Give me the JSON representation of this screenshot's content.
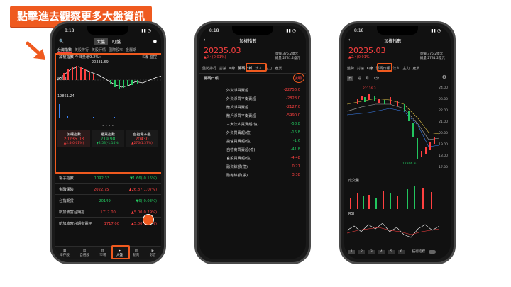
{
  "banner": "點擊進去觀察更多大盤資訊",
  "time": "8:18",
  "phone1": {
    "top_tabs": [
      "大盤",
      "盯盤"
    ],
    "market_tabs": [
      "台灣指數",
      "美股排行",
      "美股行情",
      "國際股市",
      "金屬期"
    ],
    "index_title": "加權指數",
    "today_label": "今日量增9.2%»",
    "k_label": "K線",
    "watch_label": "監控",
    "high": "20331.69",
    "base": "8233",
    "vol": "19861.24",
    "cards": [
      {
        "name": "加權指數",
        "value": "20235.03",
        "change": "▲2.4(0.01%)"
      },
      {
        "name": "櫃買指數",
        "value": "219.98",
        "change": "▼2.53(-1.14%)"
      },
      {
        "name": "台指電子盤",
        "value": "20430",
        "change": "▲276(1.37%)"
      }
    ],
    "list": [
      {
        "name": "電子指數",
        "value": "1092.33",
        "change": "▼1.66(-0.15%)"
      },
      {
        "name": "金融保險",
        "value": "2022.75",
        "change": "▲26.87(1.07%)"
      },
      {
        "name": "台指期貨",
        "value": "20149",
        "change": "▼6(-0.03%)"
      },
      {
        "name": "新加坡富台期指",
        "value": "1717.00",
        "change": "▲5.00(0.29%)"
      },
      {
        "name": "新加坡富台期指電子",
        "value": "1717.00",
        "change": "▲5.00(0.29%)"
      }
    ],
    "nav": [
      "庫存股",
      "自選股",
      "市場",
      "大盤",
      "動向",
      "影音"
    ]
  },
  "phone2": {
    "title": "加權指數",
    "price": "20235.03",
    "change": "▲2.4(0.01%)",
    "vol1": "量價 375.2億元",
    "vol2": "總量 2731.2億元",
    "tabs": [
      "盤勢排行",
      "討論",
      "K線",
      "籌碼日報",
      "法人",
      "主力",
      "產業"
    ],
    "active_tab": "籌碼日報",
    "section": "籌碼日報",
    "note": "說明",
    "rows": [
      {
        "name": "外資淨買賣超",
        "value": "-22756.0"
      },
      {
        "name": "外資淨買平衡賣超",
        "value": "-2828.0"
      },
      {
        "name": "散戶淨買賣超",
        "value": "-2127.0"
      },
      {
        "name": "散戶淨買平衡賣超",
        "value": "-5990.0"
      },
      {
        "name": "三大法人買賣超(億)",
        "value": "-58.8"
      },
      {
        "name": "外資買賣超(億)",
        "value": "-16.8"
      },
      {
        "name": "投信買賣超(億)",
        "value": "-1.6"
      },
      {
        "name": "自營商買賣超(億)",
        "value": "-41.8"
      },
      {
        "name": "官股買賣超(億)",
        "value": "-4.48"
      },
      {
        "name": "融資餘額(億)",
        "value": "0.21"
      },
      {
        "name": "融券餘額(張)",
        "value": "3.38"
      }
    ]
  },
  "phone3": {
    "title": "加權指數",
    "price": "20235.03",
    "change": "▲2.4(0.01%)",
    "vol1": "量價 375.2億元",
    "vol2": "總量 2731.2億元",
    "tabs": [
      "盤勢",
      "討論",
      "K線",
      "籌碼日報",
      "法人",
      "主力",
      "產業"
    ],
    "active_tab": "K線",
    "chart_tabs": [
      "日",
      "週",
      "月",
      "1分"
    ],
    "y_ticks": [
      "24.00",
      "23.00",
      "22.00",
      "21.00",
      "20.00",
      "19.00",
      "18.00",
      "17.00"
    ],
    "hi_label": "22116.3",
    "lo_label": "17306.97",
    "vol_label": "成交量",
    "rsi_label": "RSI",
    "pages": [
      "1",
      "2",
      "3",
      "4",
      "5",
      "6"
    ],
    "toggle_label": "技術指標"
  }
}
